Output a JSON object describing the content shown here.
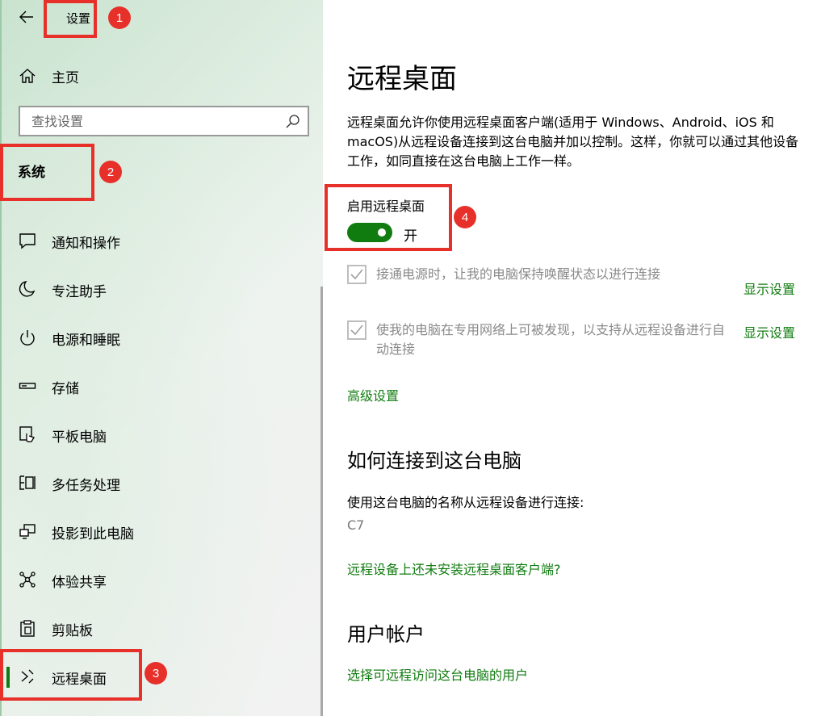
{
  "window": {
    "title": "设置"
  },
  "sidebar": {
    "home_label": "主页",
    "search_placeholder": "查找设置",
    "section_title": "系统",
    "items": [
      {
        "label": "通知和操作",
        "icon": "notification-icon"
      },
      {
        "label": "专注助手",
        "icon": "moon-icon"
      },
      {
        "label": "电源和睡眠",
        "icon": "power-icon"
      },
      {
        "label": "存储",
        "icon": "storage-icon"
      },
      {
        "label": "平板电脑",
        "icon": "tablet-icon"
      },
      {
        "label": "多任务处理",
        "icon": "multitasking-icon"
      },
      {
        "label": "投影到此电脑",
        "icon": "project-icon"
      },
      {
        "label": "体验共享",
        "icon": "share-icon"
      },
      {
        "label": "剪贴板",
        "icon": "clipboard-icon"
      },
      {
        "label": "远程桌面",
        "icon": "remote-desktop-icon",
        "selected": true
      }
    ]
  },
  "main": {
    "title": "远程桌面",
    "description": "远程桌面允许你使用远程桌面客户端(适用于 Windows、Android、iOS 和 macOS)从远程设备连接到这台电脑并加以控制。这样，你就可以通过其他设备工作，如同直接在这台电脑上工作一样。",
    "enable_label": "启用远程桌面",
    "toggle_state": "开",
    "toggle_on": true,
    "checkbox1_text": "接通电源时，让我的电脑保持唤醒状态以进行连接",
    "checkbox1_link": "显示设置",
    "checkbox2_text": "使我的电脑在专用网络上可被发现，以支持从远程设备进行自动连接",
    "checkbox2_link": "显示设置",
    "advanced_link": "高级设置",
    "how_heading": "如何连接到这台电脑",
    "how_text": "使用这台电脑的名称从远程设备进行连接:",
    "pc_name": "C7",
    "no_client_link": "远程设备上还未安装远程桌面客户端?",
    "accounts_heading": "用户帐户",
    "accounts_link": "选择可远程访问这台电脑的用户"
  },
  "annotations": [
    "1",
    "2",
    "3",
    "4"
  ],
  "colors": {
    "accent": "#107c10",
    "annotation": "#e8302a"
  }
}
